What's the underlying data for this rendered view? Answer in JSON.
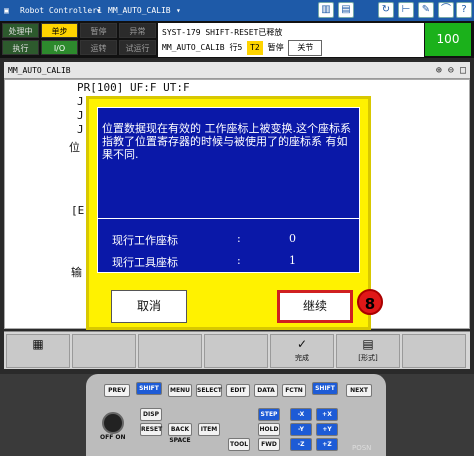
{
  "titlebar": {
    "title": "Robot Controller1",
    "program": "MM_AUTO_CALIB"
  },
  "status": {
    "labels": [
      "处理中",
      "单步",
      "暂停",
      "异常",
      "执行",
      "I/O",
      "运转",
      "试运行"
    ],
    "message_line1": "SYST-179 SHIFT-RESET已释放",
    "message_line2_prog": "MM_AUTO_CALIB",
    "message_line2_line": "行5",
    "message_line2_t": "T2",
    "message_line2_state": "暂停",
    "message_line2_btn": "关节",
    "override": "100"
  },
  "program": {
    "title": "MM_AUTO_CALIB",
    "line1": "PR[100] UF:F  UT:F",
    "line_j1": "J",
    "line_j2": "J",
    "line_j3": "J",
    "line_pos": "位",
    "line_en": "[E",
    "line_in": "输"
  },
  "dialog": {
    "message": "位置数据现在有效的 工作座标上被变换.这个座标系指教了位置寄存器的时候与被使用了的座标系 有如果不同.",
    "rows": [
      {
        "label": "现行工作座标",
        "colon": ":",
        "value": "0"
      },
      {
        "label": "现行工具座标",
        "colon": ":",
        "value": "1"
      }
    ],
    "cancel": "取消",
    "continue": "继续",
    "badge": "8"
  },
  "softkeys": {
    "complete": "完成",
    "form": "[形式]"
  },
  "keypad": {
    "prev": "PREV",
    "shift": "SHIFT",
    "menu": "MENU",
    "select": "SELECT",
    "edit": "EDIT",
    "data": "DATA",
    "fctn": "FCTN",
    "next": "NEXT",
    "disp": "DISP",
    "reset": "RESET",
    "backspace": "BACK SPACE",
    "item": "ITEM",
    "step": "STEP",
    "hold": "HOLD",
    "fwd": "FWD",
    "bwd": "BWD",
    "tool": "TOOL",
    "off": "OFF ON",
    "posn": "POSN"
  },
  "colors": {
    "dialog_bg": "#fff200",
    "dialog_panel": "#0a18a8",
    "highlight": "#d02020",
    "titlebar": "#1e5aa8"
  }
}
